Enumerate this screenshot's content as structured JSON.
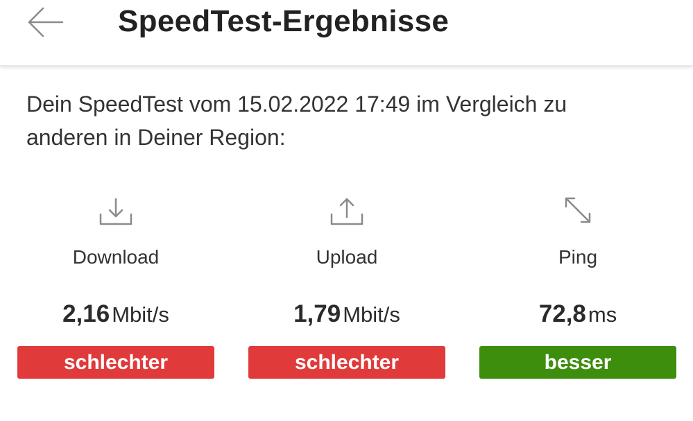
{
  "header": {
    "title": "SpeedTest-Ergebnisse",
    "back_icon": "arrow-left-icon"
  },
  "intro": {
    "text": "Dein SpeedTest vom 15.02.2022 17:49 im Vergleich zu anderen in Deiner Region:"
  },
  "metrics": [
    {
      "icon": "download-icon",
      "label": "Download",
      "value": "2,16",
      "unit": "Mbit/s",
      "rating": "schlechter",
      "rating_color": "#e03a3a"
    },
    {
      "icon": "upload-icon",
      "label": "Upload",
      "value": "1,79",
      "unit": "Mbit/s",
      "rating": "schlechter",
      "rating_color": "#e03a3a"
    },
    {
      "icon": "ping-arrows-icon",
      "label": "Ping",
      "value": "72,8",
      "unit": "ms",
      "rating": "besser",
      "rating_color": "#3e8e0e"
    }
  ],
  "colors": {
    "worse": "#e03a3a",
    "better": "#3e8e0e",
    "icon_gray": "#8a8a8a"
  }
}
